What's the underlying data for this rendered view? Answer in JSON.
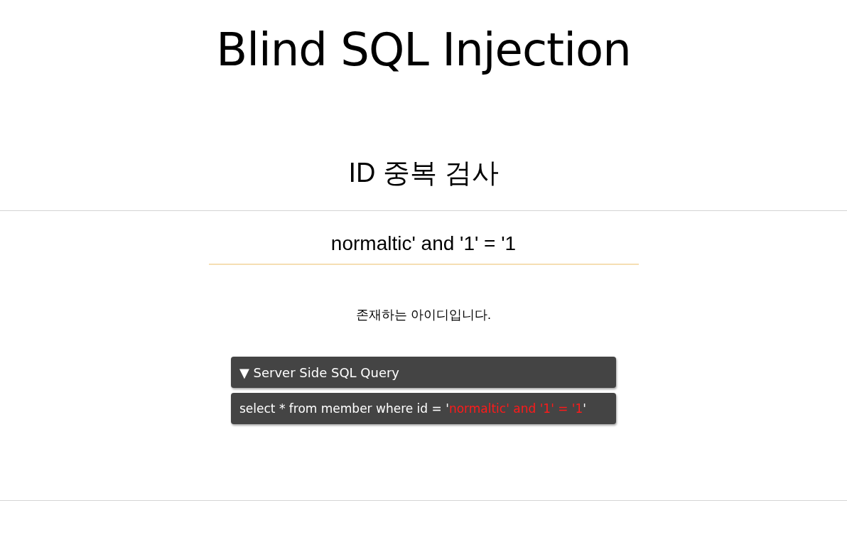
{
  "title": "Blind SQL Injection",
  "section_title": "ID 중복 검사",
  "id_input": {
    "value": "normaltic' and '1' = '1"
  },
  "result_message": "존재하는 아이디입니다.",
  "query_panel": {
    "toggle_icon": "▼",
    "label": "Server Side SQL Query",
    "query_parts": [
      {
        "text": "select * from member where id = '",
        "kind": "code"
      },
      {
        "text": "normaltic' and '1' = '1",
        "kind": "input"
      },
      {
        "text": "'",
        "kind": "code"
      }
    ]
  }
}
